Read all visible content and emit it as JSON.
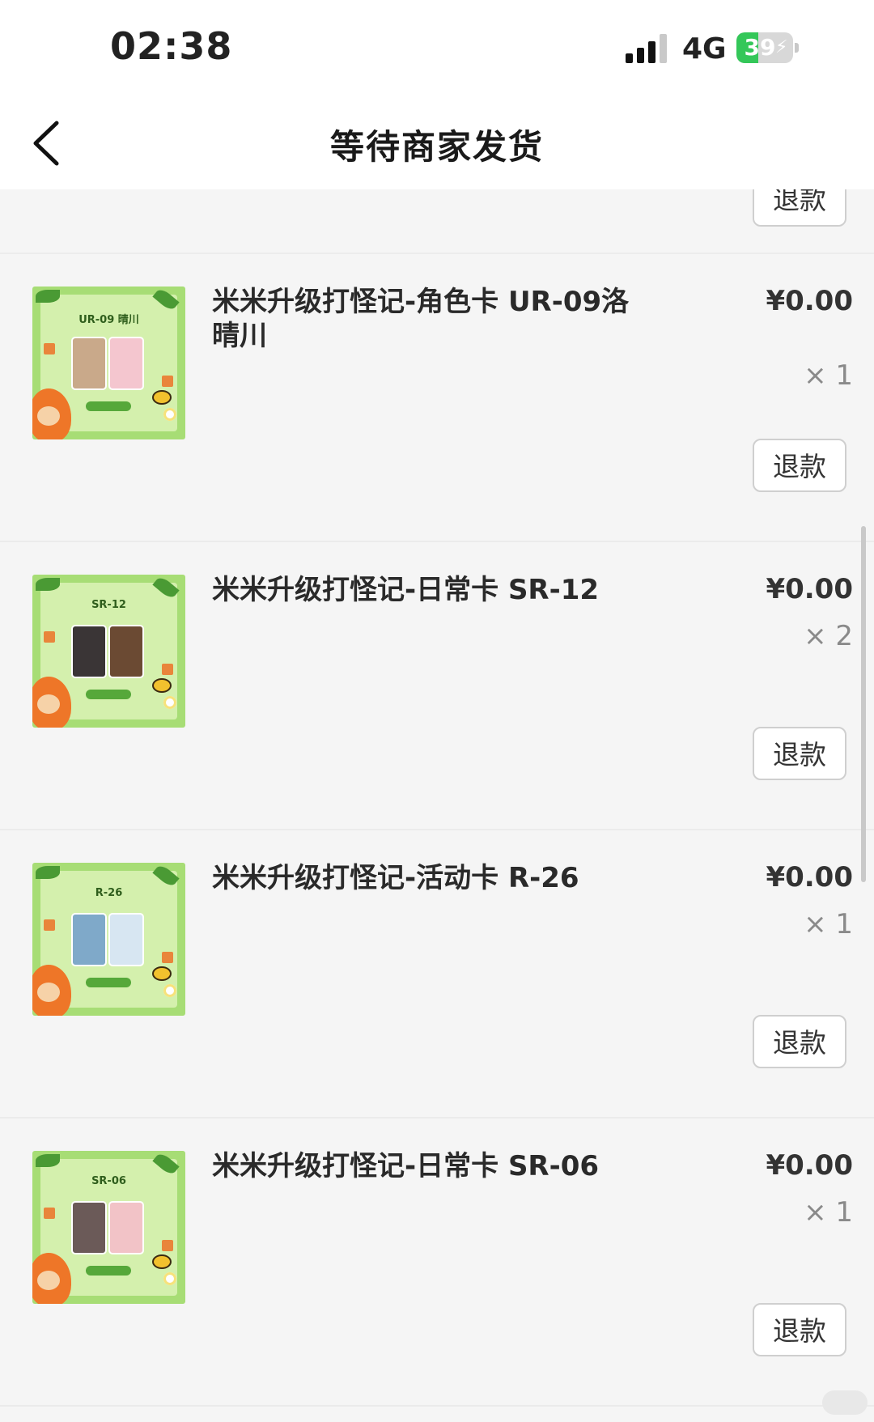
{
  "status_bar": {
    "time": "02:38",
    "network": "4G",
    "battery": "39",
    "battery_level": 0.39,
    "signal_icon": "signal-bars-icon",
    "battery_icon": "battery-charging-icon"
  },
  "nav": {
    "title": "等待商家发货",
    "back_icon": "chevron-left-icon"
  },
  "prev_item": {
    "refund_label": "退款"
  },
  "items": [
    {
      "thumb_code": "UR-09 晴川",
      "title": "米米升级打怪记-角色卡 UR-09洛晴川",
      "price": "¥0.00",
      "qty": "× 1",
      "refund_label": "退款",
      "photo_colors": [
        "#c9a98a",
        "#f4c6cf"
      ]
    },
    {
      "thumb_code": "SR-12",
      "title": "米米升级打怪记-日常卡 SR-12",
      "price": "¥0.00",
      "qty": "× 2",
      "refund_label": "退款",
      "photo_colors": [
        "#3a3536",
        "#6b4a33"
      ]
    },
    {
      "thumb_code": "R-26",
      "title": "米米升级打怪记-活动卡 R-26",
      "price": "¥0.00",
      "qty": "× 1",
      "refund_label": "退款",
      "photo_colors": [
        "#7fa9c9",
        "#d7e6f2"
      ]
    },
    {
      "thumb_code": "SR-06",
      "title": "米米升级打怪记-日常卡 SR-06",
      "price": "¥0.00",
      "qty": "× 1",
      "refund_label": "退款",
      "photo_colors": [
        "#6b5a58",
        "#f2c3c7"
      ]
    }
  ],
  "colors": {
    "page_bg": "#f5f5f5",
    "header_bg": "#ffffff",
    "battery_green": "#34c759",
    "thumb_green": "#a7dd75"
  }
}
